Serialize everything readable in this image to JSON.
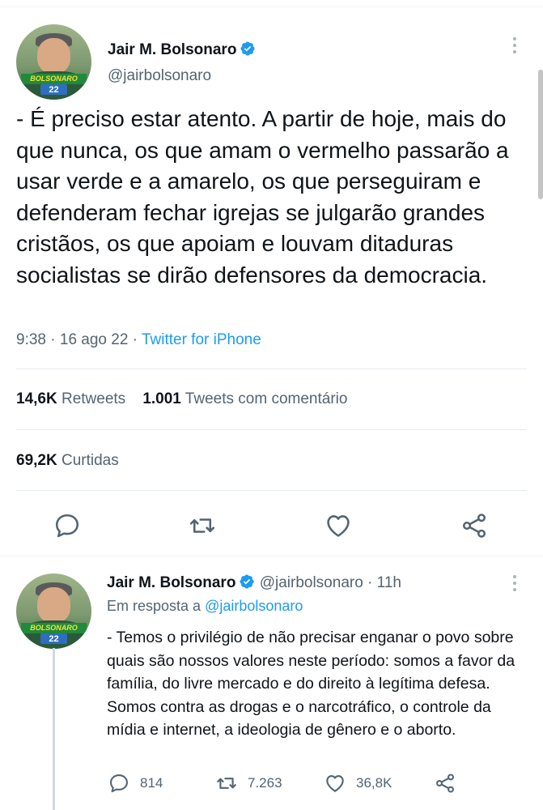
{
  "colors": {
    "accent": "#1d9bf0",
    "text": "#0f1419",
    "secondary": "#536471",
    "divider": "#e6ecf0"
  },
  "main_tweet": {
    "author_name": "Jair M. Bolsonaro",
    "handle": "@jairbolsonaro",
    "avatar_banner": "BOLSONARO",
    "avatar_number": "22",
    "text": "- É preciso estar atento. A partir de hoje, mais do que nunca, os que amam o vermelho passarão a usar verde e a amarelo, os que perseguiram e defenderam fechar igrejas se julgarão grandes cristãos, os que apoiam e louvam ditaduras socialistas se dirão defensores da democracia.",
    "time": "9:38",
    "date": "16 ago 22",
    "source": "Twitter for iPhone",
    "retweets_count": "14,6K",
    "retweets_label": "Retweets",
    "quotes_count": "1.001",
    "quotes_label": "Tweets com comentário",
    "likes_count": "69,2K",
    "likes_label": "Curtidas",
    "actions": [
      "reply-icon",
      "retweet-icon",
      "like-icon",
      "share-icon"
    ]
  },
  "reply_tweet": {
    "author_name": "Jair M. Bolsonaro",
    "handle": "@jairbolsonaro",
    "time_ago": "11h",
    "reply_prefix": "Em resposta a",
    "reply_mention": "@jairbolsonaro",
    "avatar_banner": "BOLSONARO",
    "avatar_number": "22",
    "text": "- Temos o privilégio de não precisar enganar o povo sobre quais são nossos valores neste período: somos a favor da família, do livre mercado e do direito à legítima defesa. Somos contra as drogas e o narcotráfico, o controle da mídia e internet, a ideologia de gênero e o aborto.",
    "replies": "814",
    "retweets": "7.263",
    "likes": "36,8K"
  }
}
